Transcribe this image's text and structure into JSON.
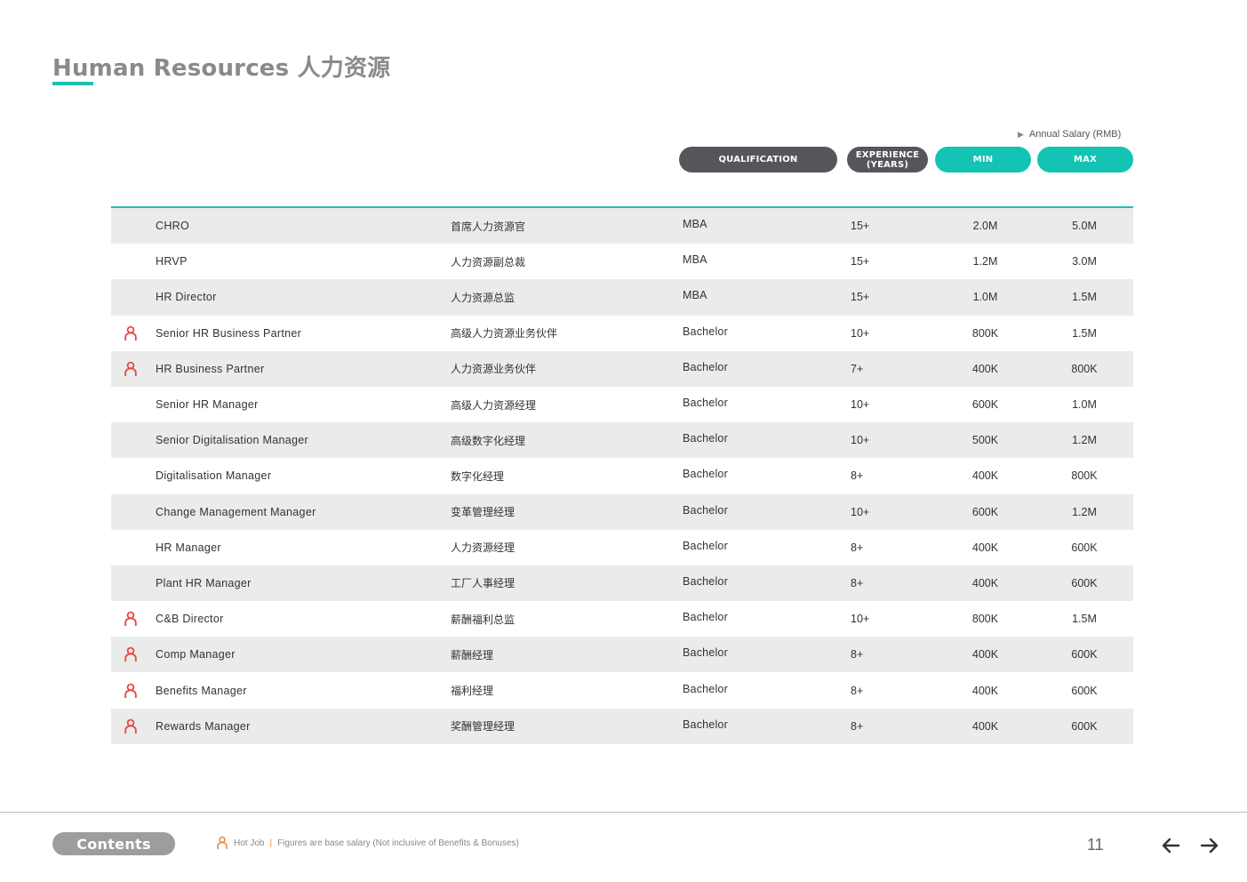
{
  "page": {
    "title": "Human Resources 人力资源",
    "annual_salary_note": "Annual Salary (RMB)"
  },
  "headers": {
    "qualification": "QUALIFICATION",
    "experience_line1": "EXPERIENCE",
    "experience_line2": "(YEARS)",
    "min": "MIN",
    "max": "MAX"
  },
  "rows": [
    {
      "en": "CHRO",
      "cn": "首席人力资源官",
      "qualification": "MBA",
      "experience": "15+",
      "min": "2.0M",
      "max": "5.0M",
      "hot": false
    },
    {
      "en": "HRVP",
      "cn": "人力资源副总裁",
      "qualification": "MBA",
      "experience": "15+",
      "min": "1.2M",
      "max": "3.0M",
      "hot": false
    },
    {
      "en": "HR Director",
      "cn": "人力资源总监",
      "qualification": "MBA",
      "experience": "15+",
      "min": "1.0M",
      "max": "1.5M",
      "hot": false
    },
    {
      "en": "Senior HR Business Partner",
      "cn": "高级人力资源业务伙伴",
      "qualification": "Bachelor",
      "experience": "10+",
      "min": "800K",
      "max": "1.5M",
      "hot": true
    },
    {
      "en": "HR Business Partner",
      "cn": "人力资源业务伙伴",
      "qualification": "Bachelor",
      "experience": "7+",
      "min": "400K",
      "max": "800K",
      "hot": true
    },
    {
      "en": "Senior HR Manager",
      "cn": "高级人力资源经理",
      "qualification": "Bachelor",
      "experience": "10+",
      "min": "600K",
      "max": "1.0M",
      "hot": false
    },
    {
      "en": "Senior Digitalisation Manager",
      "cn": "高级数字化经理",
      "qualification": "Bachelor",
      "experience": "10+",
      "min": "500K",
      "max": "1.2M",
      "hot": false
    },
    {
      "en": "Digitalisation Manager",
      "cn": "数字化经理",
      "qualification": "Bachelor",
      "experience": "8+",
      "min": "400K",
      "max": "800K",
      "hot": false
    },
    {
      "en": "Change Management Manager",
      "cn": "变革管理经理",
      "qualification": "Bachelor",
      "experience": "10+",
      "min": "600K",
      "max": "1.2M",
      "hot": false
    },
    {
      "en": "HR Manager",
      "cn": "人力资源经理",
      "qualification": "Bachelor",
      "experience": "8+",
      "min": "400K",
      "max": "600K",
      "hot": false
    },
    {
      "en": "Plant HR Manager",
      "cn": "工厂人事经理",
      "qualification": "Bachelor",
      "experience": "8+",
      "min": "400K",
      "max": "600K",
      "hot": false
    },
    {
      "en": "C&B Director",
      "cn": "薪酬福利总监",
      "qualification": "Bachelor",
      "experience": "10+",
      "min": "800K",
      "max": "1.5M",
      "hot": true
    },
    {
      "en": "Comp Manager",
      "cn": "薪酬经理",
      "qualification": "Bachelor",
      "experience": "8+",
      "min": "400K",
      "max": "600K",
      "hot": true
    },
    {
      "en": "Benefits Manager",
      "cn": "福利经理",
      "qualification": "Bachelor",
      "experience": "8+",
      "min": "400K",
      "max": "600K",
      "hot": true
    },
    {
      "en": "Rewards Manager",
      "cn": "奖酬管理经理",
      "qualification": "Bachelor",
      "experience": "8+",
      "min": "400K",
      "max": "600K",
      "hot": true
    }
  ],
  "footer": {
    "contents_label": "Contents",
    "hot_job_label": "Hot Job",
    "separator": "|",
    "note": "Figures are base salary (Not inclusive of Benefits & Bonuses)",
    "page_number": "11"
  },
  "icons": {
    "hot_job": "person-icon",
    "prev": "arrow-left-icon",
    "next": "arrow-right-icon"
  },
  "colors": {
    "accent_teal": "#13c3b3",
    "dark_pill": "#54565b",
    "hot_icon": "#e8453c",
    "row_shade": "#ebebeb"
  }
}
